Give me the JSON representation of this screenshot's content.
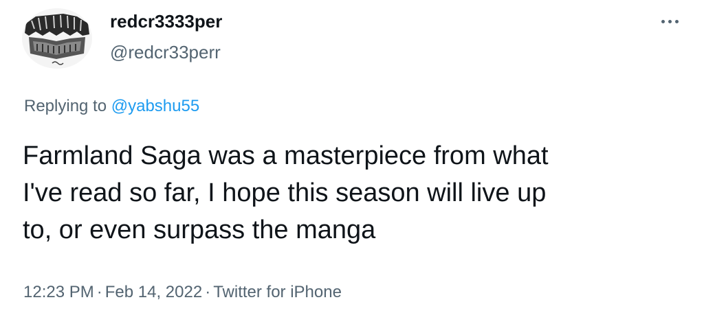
{
  "author": {
    "display_name": "redcr3333per",
    "handle": "@redcr33perr"
  },
  "icons": {
    "more": "more-horizontal-icon",
    "avatar": "avatar-image"
  },
  "reply": {
    "prefix": "Replying to ",
    "mention": "@yabshu55"
  },
  "tweet": {
    "text": "Farmland Saga was a masterpiece from what\nI've read so far, I hope this season will live up\nto, or even surpass the manga"
  },
  "meta": {
    "time": "12:23 PM",
    "separator": "·",
    "date": "Feb 14, 2022",
    "source": "Twitter for iPhone"
  },
  "colors": {
    "text_primary": "#0f1419",
    "text_secondary": "#536471",
    "accent": "#1d9bf0"
  }
}
